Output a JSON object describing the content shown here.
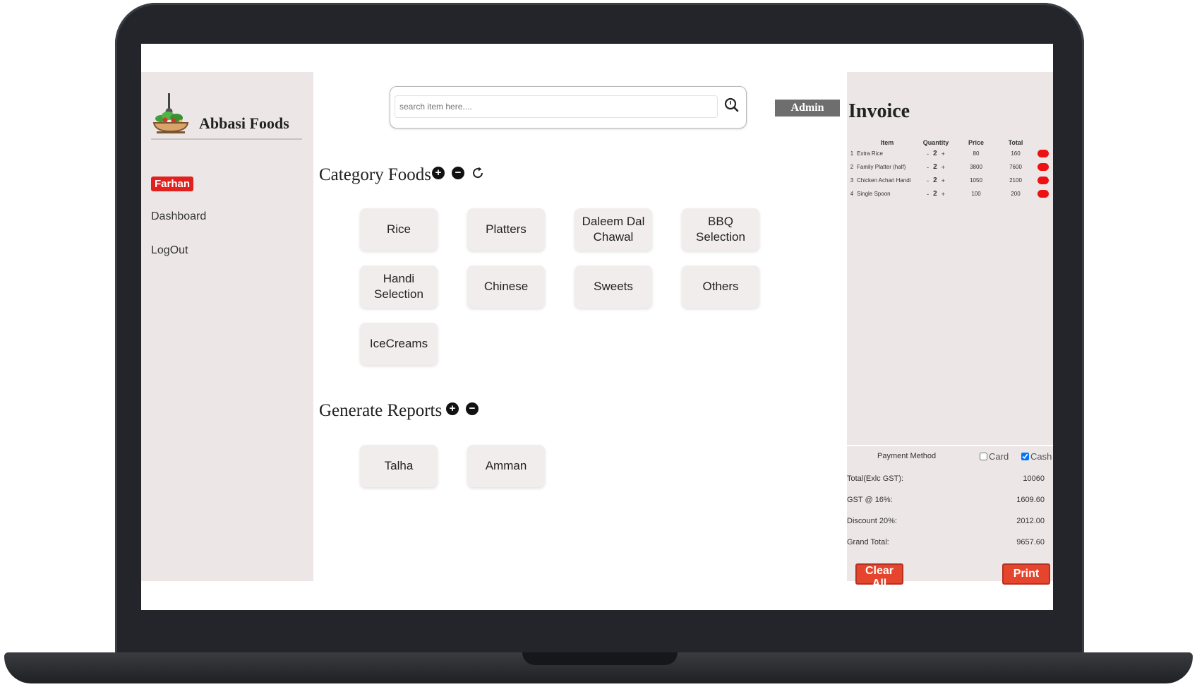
{
  "brand": {
    "name": "Abbasi Foods",
    "logo_icon": "salad-bowl-icon"
  },
  "sidebar": {
    "user": "Farhan",
    "links": [
      {
        "label": "Dashboard"
      },
      {
        "label": "LogOut"
      }
    ]
  },
  "search": {
    "placeholder": "search item here....",
    "icon": "search-icon"
  },
  "admin_label": "Admin",
  "category_section": {
    "title": "Category Foods",
    "categories": [
      "Rice",
      "Platters",
      "Daleem Dal Chawal",
      "BBQ Selection",
      "Handi Selection",
      "Chinese",
      "Sweets",
      "Others",
      "IceCreams"
    ]
  },
  "reports_section": {
    "title": "Generate Reports",
    "reports": [
      "Talha",
      "Amman"
    ]
  },
  "invoice": {
    "title": "Invoice",
    "headers": [
      "Item",
      "Quantity",
      "Price",
      "Total"
    ],
    "items": [
      {
        "no": "1",
        "item": "Extra Rice",
        "qty": "2",
        "price": "80",
        "total": "160"
      },
      {
        "no": "2",
        "item": "Family Platter (half)",
        "qty": "2",
        "price": "3800",
        "total": "7600"
      },
      {
        "no": "3",
        "item": "Chicken Achari Handi",
        "qty": "2",
        "price": "1050",
        "total": "2100"
      },
      {
        "no": "4",
        "item": "Single Spoon",
        "qty": "2",
        "price": "100",
        "total": "200"
      }
    ],
    "payment": {
      "label": "Payment Method",
      "options": [
        {
          "label": "Card",
          "checked": false
        },
        {
          "label": "Cash",
          "checked": true
        }
      ]
    },
    "summary": [
      {
        "label": "Total(Exlc GST):",
        "value": "10060"
      },
      {
        "label": "GST @ 16%:",
        "value": "1609.60"
      },
      {
        "label": "Discount 20%:",
        "value": "2012.00"
      },
      {
        "label": "Grand Total:",
        "value": "9657.60"
      }
    ],
    "clear_label": "Clear All",
    "print_label": "Print"
  },
  "colors": {
    "accent_red": "#e5442d",
    "badge_red": "#e0211d",
    "panel_bg": "#ede6e6",
    "frame": "#23252a"
  }
}
